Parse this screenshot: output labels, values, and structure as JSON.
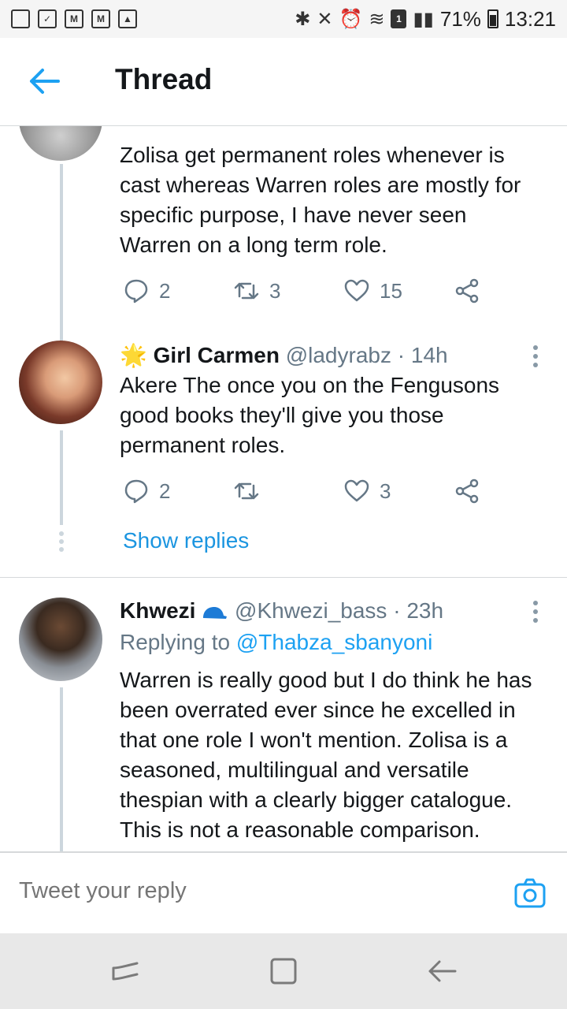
{
  "status_bar": {
    "battery": "71%",
    "time": "13:21",
    "sim_badge": "1"
  },
  "header": {
    "title": "Thread"
  },
  "tweets": [
    {
      "text_lines": [
        "Zolisa get permanent roles whenever is",
        "cast whereas Warren roles are mostly for",
        "specific purpose, I have never seen",
        "Warren on a long term role."
      ],
      "replies": "2",
      "retweets": "3",
      "likes": "15"
    },
    {
      "emoji": "🌟",
      "name": "Girl Carmen",
      "handle": "@ladyrabz",
      "time": "· 14h",
      "text_lines": [
        "Akere The once you on the Fengusons",
        "good books they'll give you those",
        "permanent roles."
      ],
      "replies": "2",
      "retweets": "",
      "likes": "3",
      "show_replies": "Show replies"
    },
    {
      "name": "Khwezi",
      "handle": "@Khwezi_bass",
      "time": "· 23h",
      "replying_prefix": "Replying to",
      "replying_handle": "@Thabza_sbanyoni",
      "text_lines": [
        "Warren is really good but I do think he has",
        "been overrated ever since he excelled in",
        "that one role I won't mention. Zolisa is a",
        "seasoned, multilingual and versatile",
        "thespian with a clearly bigger catalogue.",
        "This is not a reasonable comparison."
      ]
    }
  ],
  "reply_bar": {
    "placeholder": "Tweet your reply"
  },
  "colors": {
    "accent": "#1da1f2",
    "text": "#14171a",
    "muted": "#657786",
    "divider": "#d6d9db"
  }
}
